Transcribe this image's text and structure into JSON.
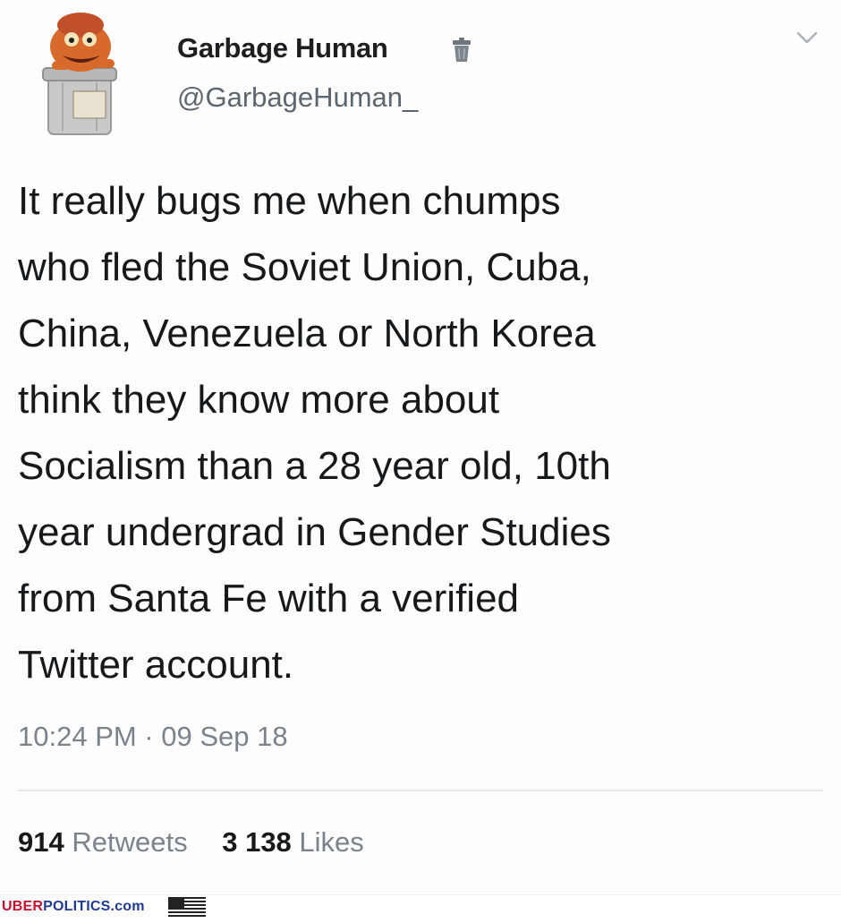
{
  "tweet": {
    "display_name": "Garbage Human",
    "handle": "@GarbageHuman_",
    "avatar_label": "GARBAGE HUMAN",
    "text_lines": [
      "It really bugs me when chumps",
      "who fled the Soviet Union, Cuba,",
      "China, Venezuela or North Korea",
      "think they know more about",
      "Socialism than a 28 year old, 10th",
      "year undergrad in Gender Studies",
      "from Santa Fe with a verified",
      "Twitter account."
    ],
    "timestamp": "10:24 PM · 09 Sep 18",
    "retweets_count": "914",
    "retweets_label": "Retweets",
    "likes_count": "3 138",
    "likes_label": "Likes",
    "icons": {
      "avatar": "garbage-can-muppet-avatar",
      "name_badge": "trash-can-icon",
      "menu": "chevron-down-icon"
    }
  },
  "footer": {
    "brand_red": "UBER",
    "brand_blue": "POLITICS.com",
    "flag_icon": "us-flag-icon"
  },
  "colors": {
    "text": "#16191c",
    "muted": "#7a838b",
    "brand_red": "#c8102e",
    "brand_blue": "#1f3a93"
  }
}
